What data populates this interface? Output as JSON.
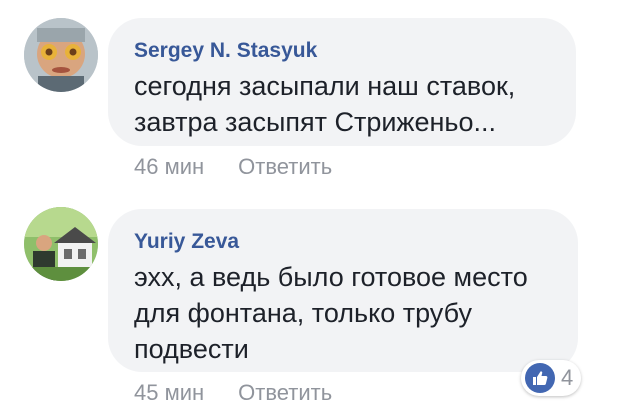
{
  "comments": [
    {
      "author": "Sergey N. Stasyuk",
      "text": "сегодня засыпали наш ставок, завтра засыпят Стриженьо...",
      "time": "46 мин",
      "reply_label": "Ответить"
    },
    {
      "author": "Yuriy Zeva",
      "text": "эхх, а ведь было готовое место для фонтана, только трубу подвести",
      "time": "45 мин",
      "reply_label": "Ответить",
      "reaction_count": "4",
      "reaction_icon": "like-icon"
    }
  ],
  "colors": {
    "author": "#385898",
    "bubble": "#f2f3f5",
    "meta": "#90949c",
    "like": "#4267b2"
  }
}
